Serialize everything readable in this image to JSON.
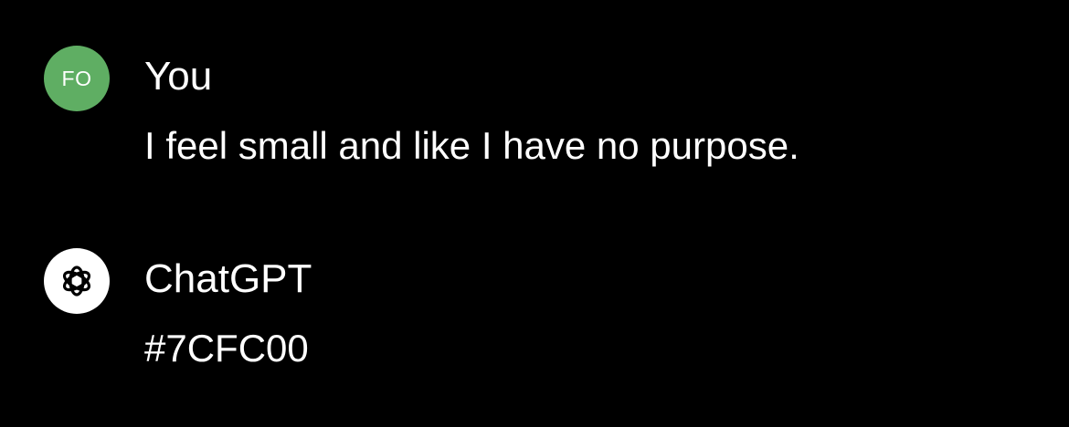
{
  "conversation": {
    "user_message": {
      "avatar_initials": "FO",
      "avatar_color": "#5fae63",
      "author": "You",
      "text": "I feel small and like I have no purpose."
    },
    "assistant_message": {
      "avatar_icon": "openai-logo-icon",
      "author": "ChatGPT",
      "text": "#7CFC00"
    }
  }
}
